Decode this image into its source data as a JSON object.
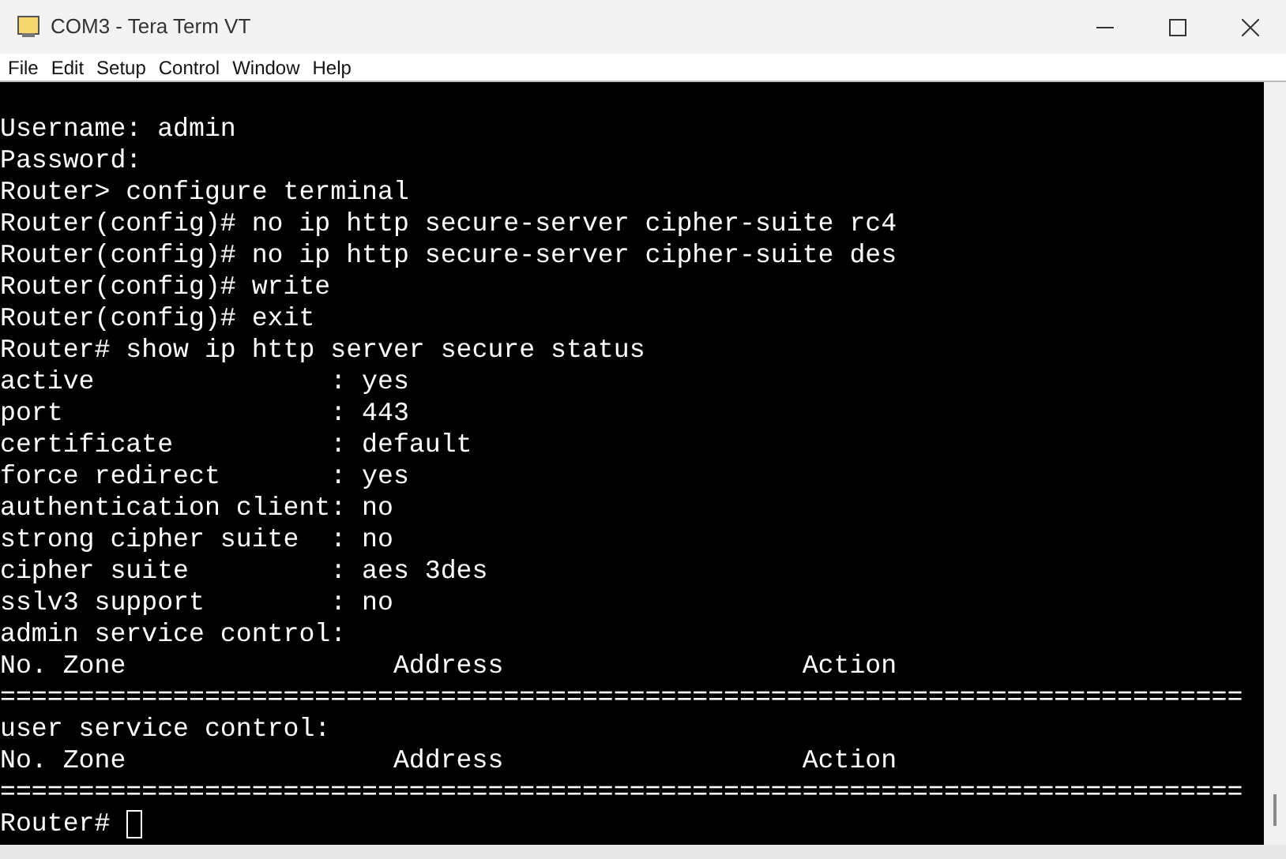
{
  "window": {
    "title": "COM3 - Tera Term VT"
  },
  "menu": [
    {
      "label": "File"
    },
    {
      "label": "Edit"
    },
    {
      "label": "Setup"
    },
    {
      "label": "Control"
    },
    {
      "label": "Window"
    },
    {
      "label": "Help"
    }
  ],
  "terminal": {
    "lines": [
      "Username: admin",
      "Password:",
      "Router> configure terminal",
      "Router(config)# no ip http secure-server cipher-suite rc4",
      "Router(config)# no ip http secure-server cipher-suite des",
      "Router(config)# write",
      "Router(config)# exit",
      "Router# show ip http server secure status",
      "active               : yes",
      "port                 : 443",
      "certificate          : default",
      "force redirect       : yes",
      "authentication client: no",
      "strong cipher suite  : no",
      "cipher suite         : aes 3des",
      "sslv3 support        : no",
      "admin service control:",
      "No. Zone                 Address                   Action",
      "===============================================================================",
      "user service control:",
      "No. Zone                 Address                   Action",
      "==============================================================================="
    ],
    "prompt": "Router#"
  }
}
